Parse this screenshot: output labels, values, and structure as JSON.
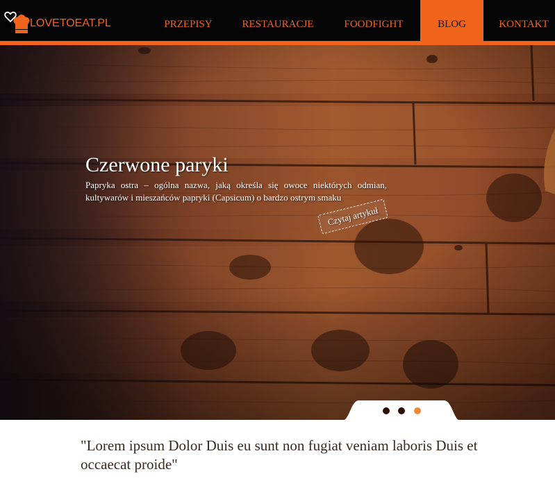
{
  "header": {
    "logo_text": "LOVETOEAT.PL",
    "nav": {
      "przepisy": "PRZEPISY",
      "restauracje": "RESTAURACJE",
      "foodfight": "FOODFIGHT",
      "blog": "BLOG",
      "kontakt": "KONTAKT"
    },
    "active_item": "BLOG"
  },
  "hero": {
    "title": "Czerwone paryki",
    "description": "Papryka ostra – ogólna nazwa, jaką określa się owoce niektórych odmian, kultywarów i mieszańców papryki (Capsicum) o bardzo ostrym smaku",
    "button_label": "Czytaj artykuł"
  },
  "slider": {
    "slide_count": 3,
    "active_slide": 3
  },
  "quote": {
    "text": "\"Lorem ipsum Dolor Duis eu sunt non fugiat veniam laboris Duis et occaecat proide\""
  },
  "colors": {
    "accent": "#f0641b",
    "nav_background": "#050505",
    "active_dot": "#f0883b",
    "inactive_dot": "#2a1005"
  },
  "icons": [
    "heart-icon",
    "chef-hat-icon"
  ]
}
